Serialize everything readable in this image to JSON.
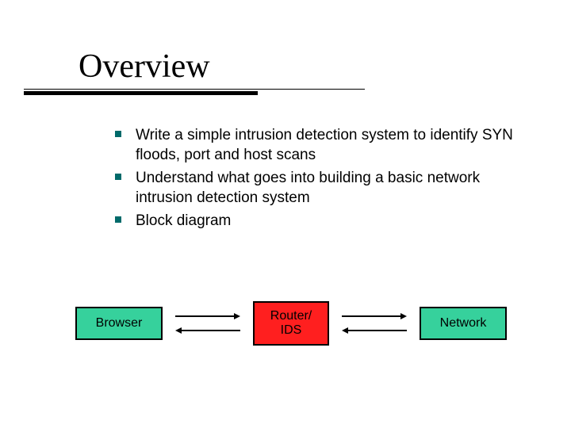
{
  "title": "Overview",
  "bullets": [
    "Write a simple intrusion detection system to identify SYN floods, port and host scans",
    "Understand what goes into building a basic network intrusion detection system",
    "Block diagram"
  ],
  "diagram": {
    "browser": "Browser",
    "router_line1": "Router/",
    "router_line2": "IDS",
    "network": "Network"
  }
}
